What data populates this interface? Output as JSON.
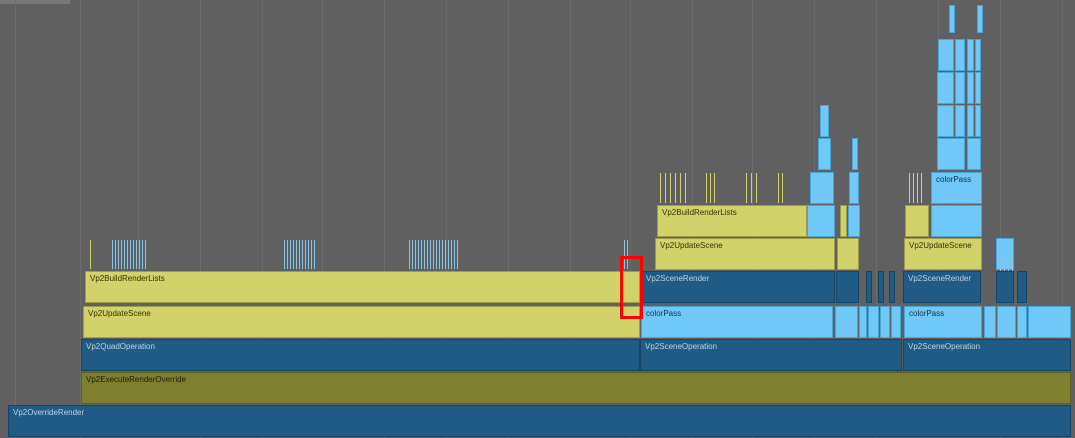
{
  "events": {
    "override_render": "Vp2OverrideRender",
    "execute_render_override": "Vp2ExecuteRenderOverride",
    "quad_operation": "Vp2QuadOperation",
    "update_scene_left": "Vp2UpdateScene",
    "build_render_lists_left": "Vp2BuildRenderLists",
    "scene_operation_1": "Vp2SceneOperation",
    "scene_operation_2": "Vp2SceneOperation",
    "color_pass_1": "colorPass",
    "color_pass_2": "colorPass",
    "color_pass_3": "colorPass",
    "scene_render_1": "Vp2SceneRender",
    "scene_render_2": "Vp2SceneRender",
    "update_scene_1": "Vp2UpdateScene",
    "update_scene_2": "Vp2UpdateScene",
    "build_render_lists_right": "Vp2BuildRenderLists"
  },
  "colors": {
    "yellow": "#d2d26a",
    "olive": "#7f7f30",
    "dark_blue": "#1f5b84",
    "light_blue": "#70c8f8",
    "highlight": "#ff0000"
  }
}
